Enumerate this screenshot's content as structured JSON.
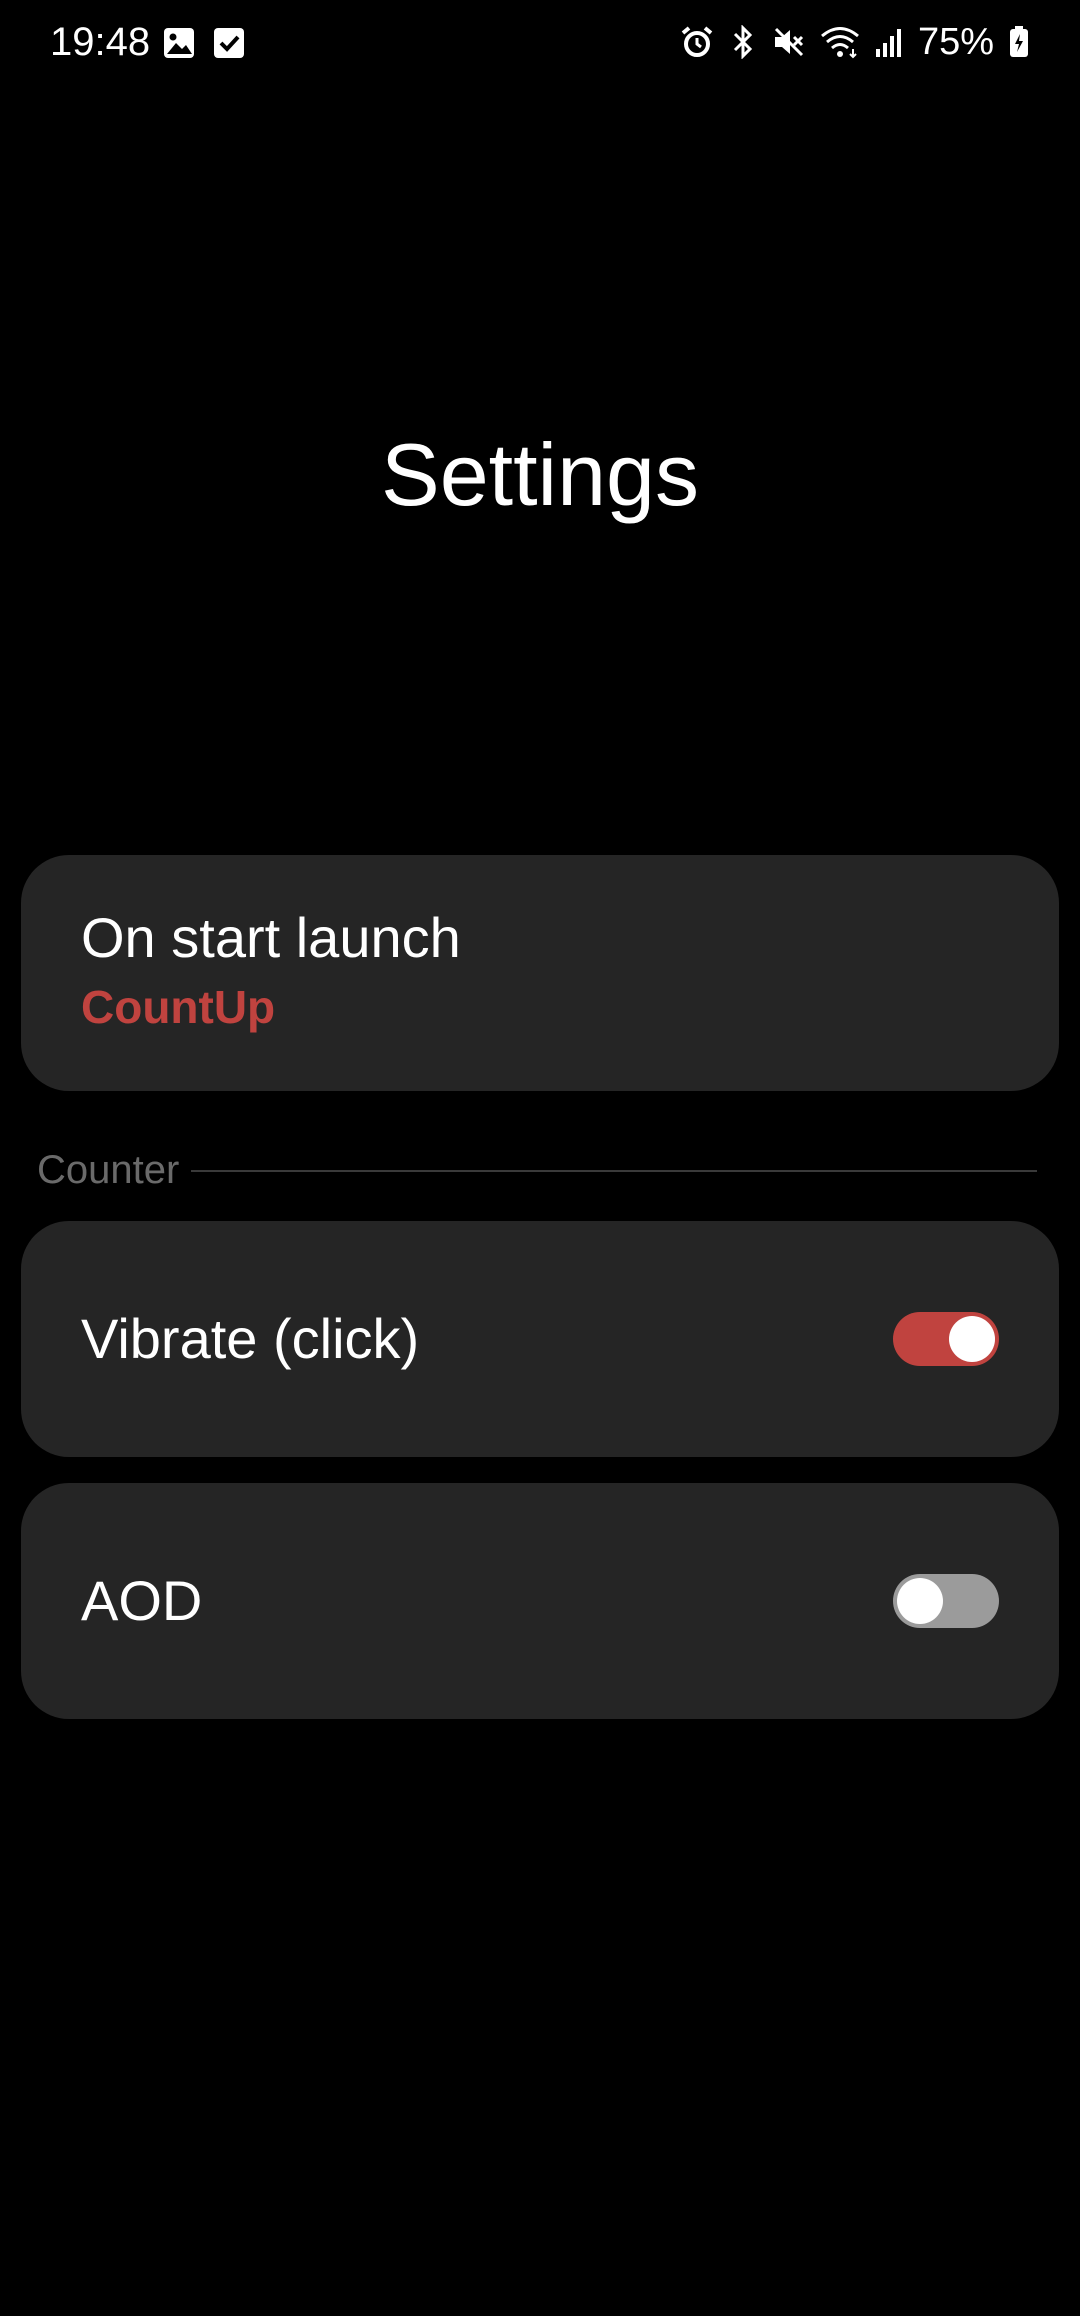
{
  "status_bar": {
    "time": "19:48",
    "left_icons": [
      "gallery-icon",
      "checkbox-icon"
    ],
    "right_icons": [
      "alarm-icon",
      "bluetooth-icon",
      "mute-icon",
      "wifi-icon",
      "signal-icon",
      "battery-charging-icon"
    ],
    "battery": "75%"
  },
  "header": {
    "title": "Settings"
  },
  "settings": {
    "on_start": {
      "label": "On start launch",
      "value": "CountUp"
    },
    "section": {
      "label": "Counter"
    },
    "vibrate": {
      "label": "Vibrate (click)",
      "enabled": true
    },
    "aod": {
      "label": "AOD",
      "enabled": false
    }
  },
  "colors": {
    "accent": "#c0433f",
    "card_background": "#252525",
    "background": "#000000",
    "toggle_off": "#9b9b9b"
  }
}
